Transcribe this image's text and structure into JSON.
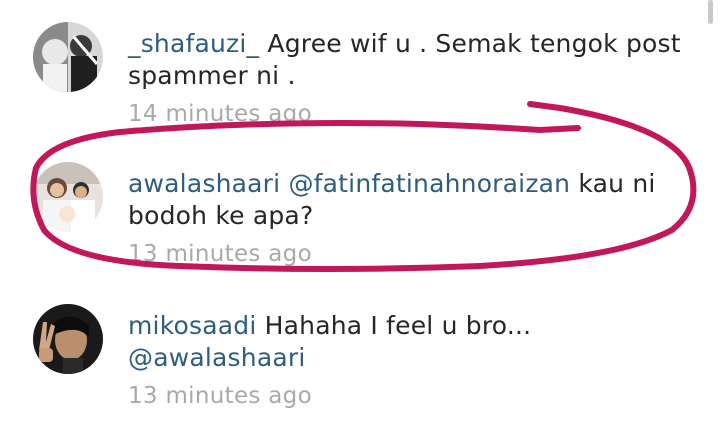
{
  "comments": [
    {
      "username": "_shafauzi_",
      "text": "Agree wif u . Semak tengok post spammer ni .",
      "mention": "",
      "time": "14 minutes ago",
      "avatar_icon": "user-avatar-bw-photo"
    },
    {
      "username": "awalashaari",
      "mention": "@fatinfatinahnoraizan",
      "text": "kau ni bodoh ke apa?",
      "time": "13 minutes ago",
      "avatar_icon": "user-avatar-family-photo"
    },
    {
      "username": "mikosaadi",
      "text": "Hahaha I feel u bro...",
      "mention": "@awalashaari",
      "time": "13 minutes ago",
      "avatar_icon": "user-avatar-peace-sign-photo"
    }
  ],
  "colors": {
    "username": "#2f5d7e",
    "text": "#262626",
    "timestamp": "#a7a9ab",
    "annotation": "#c2185b"
  }
}
